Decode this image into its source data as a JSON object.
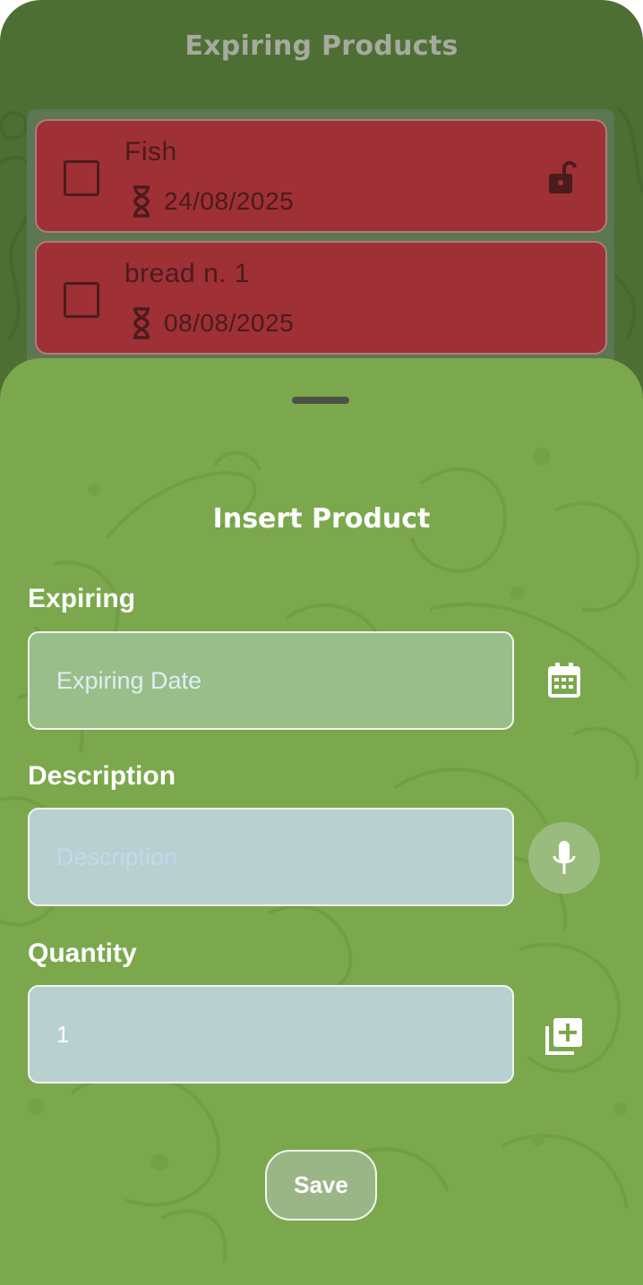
{
  "header": {
    "title": "Expiring Products"
  },
  "products": [
    {
      "name": "Fish",
      "expiry": "24/08/2025",
      "icon": "hourglass-icon",
      "lock_icon": "lock-open-icon"
    },
    {
      "name": "bread  n. 1",
      "expiry": "08/08/2025",
      "icon": "hourglass-icon"
    }
  ],
  "sheet": {
    "title": "Insert Product",
    "expiring": {
      "label": "Expiring",
      "placeholder": "Expiring Date",
      "icon": "calendar-icon"
    },
    "description": {
      "label": "Description",
      "placeholder": "Description",
      "icon": "microphone-icon"
    },
    "quantity": {
      "label": "Quantity",
      "value": "1",
      "icon": "add-to-queue-icon"
    },
    "save_label": "Save"
  },
  "colors": {
    "background_green": "#4e6f34",
    "sheet_green": "#7ba84d",
    "card_red": "#9e3036"
  }
}
